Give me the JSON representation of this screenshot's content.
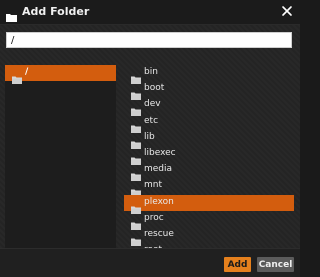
{
  "dialog": {
    "title": "Add Folder",
    "close_icon": "close-icon",
    "title_icon": "folder-icon"
  },
  "path_input": {
    "value": "/"
  },
  "left_pane": {
    "items": [
      {
        "label": "/",
        "icon": "folder-icon",
        "selected": true
      }
    ]
  },
  "right_pane": {
    "items": [
      {
        "label": "bin",
        "icon": "folder-icon",
        "selected": false
      },
      {
        "label": "boot",
        "icon": "folder-icon",
        "selected": false
      },
      {
        "label": "dev",
        "icon": "folder-icon",
        "selected": false
      },
      {
        "label": "etc",
        "icon": "folder-icon",
        "selected": false
      },
      {
        "label": "lib",
        "icon": "folder-icon",
        "selected": false
      },
      {
        "label": "libexec",
        "icon": "folder-icon",
        "selected": false
      },
      {
        "label": "media",
        "icon": "folder-icon",
        "selected": false
      },
      {
        "label": "mnt",
        "icon": "folder-icon",
        "selected": false
      },
      {
        "label": "plexon",
        "icon": "folder-icon",
        "selected": true
      },
      {
        "label": "proc",
        "icon": "folder-icon",
        "selected": false
      },
      {
        "label": "rescue",
        "icon": "folder-icon",
        "selected": false
      },
      {
        "label": "root",
        "icon": "folder-icon",
        "selected": false
      }
    ]
  },
  "footer": {
    "add_label": "Add",
    "cancel_label": "Cancel"
  },
  "colors": {
    "accent": "#d35d0e",
    "add_button": "#e5801d",
    "cancel_button": "#5b5b5b"
  }
}
